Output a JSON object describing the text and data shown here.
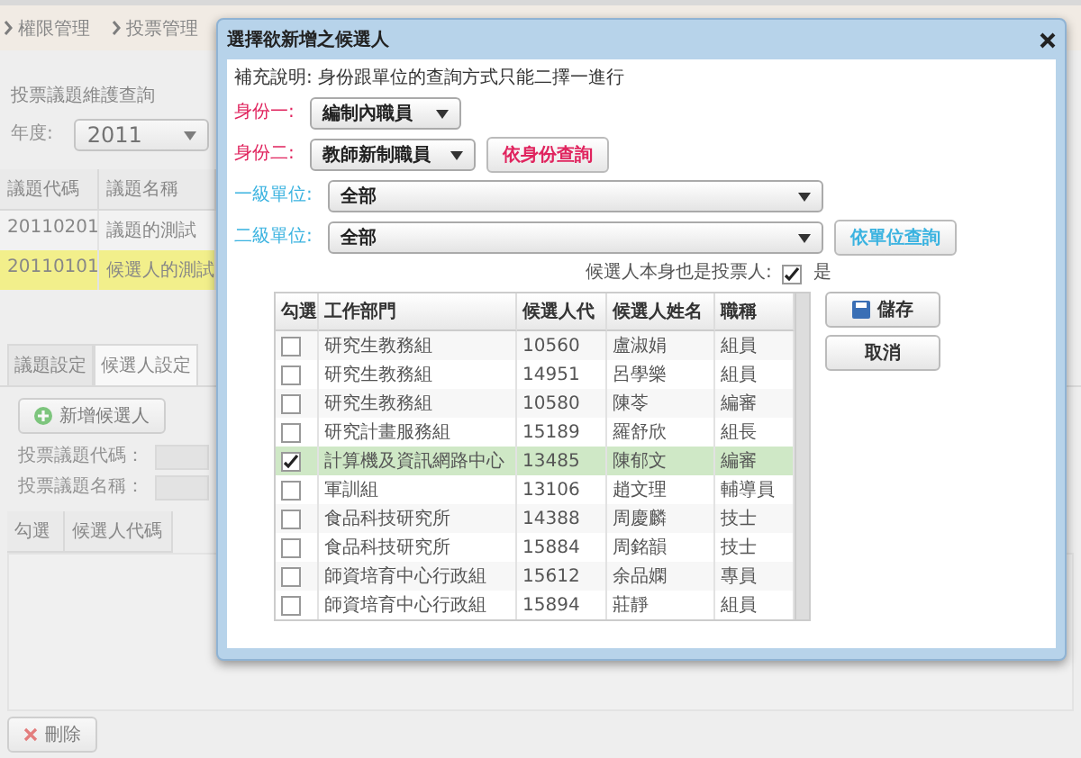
{
  "breadcrumb": [
    "權限管理",
    "投票管理"
  ],
  "query_panel": {
    "title": "投票議題維護查詢",
    "year_label": "年度:",
    "year_value": "2011"
  },
  "topic_table": {
    "columns": [
      "議題代碼",
      "議題名稱"
    ],
    "rows": [
      {
        "cells": [
          "20110201",
          "議題的測試"
        ],
        "selected": false
      },
      {
        "cells": [
          "20110101",
          "候選人的測試"
        ],
        "selected": true
      }
    ]
  },
  "tabs": [
    {
      "label": "議題設定",
      "selected": false
    },
    {
      "label": "候選人設定",
      "selected": true
    }
  ],
  "add_button": "新增候選人",
  "fields": [
    {
      "label": "投票議題代碼："
    },
    {
      "label": "投票議題名稱："
    }
  ],
  "candidate_table": {
    "columns": [
      "勾選",
      "候選人代碼"
    ]
  },
  "delete_button": "刪除",
  "dialog": {
    "title": "選擇欲新增之候選人",
    "note": "補充說明: 身份跟單位的查詢方式只能二擇一進行",
    "identity_1": {
      "label": "身份一:",
      "value": "編制內職員"
    },
    "identity_2": {
      "label": "身份二:",
      "value": "教師新制職員",
      "button": "依身份查詢"
    },
    "unit_1": {
      "label": "一級單位:",
      "value": "全部"
    },
    "unit_2": {
      "label": "二級單位:",
      "value": "全部",
      "button": "依單位查詢"
    },
    "also_voter": {
      "label": "候選人本身也是投票人:",
      "checked": true,
      "text": "是"
    },
    "check_column": "勾選",
    "columns": [
      "工作部門",
      "候選人代",
      "候選人姓名",
      "職稱"
    ],
    "rows": [
      {
        "checked": false,
        "selected": false,
        "cells": [
          "研究生教務組",
          "10560",
          "盧淑娟",
          "組員"
        ]
      },
      {
        "checked": false,
        "selected": false,
        "cells": [
          "研究生教務組",
          "14951",
          "呂學樂",
          "組員"
        ]
      },
      {
        "checked": false,
        "selected": false,
        "cells": [
          "研究生教務組",
          "10580",
          "陳苓",
          "編審"
        ]
      },
      {
        "checked": false,
        "selected": false,
        "cells": [
          "研究計畫服務組",
          "15189",
          "羅舒欣",
          "組長"
        ]
      },
      {
        "checked": true,
        "selected": true,
        "cells": [
          "計算機及資訊網路中心",
          "13485",
          "陳郁文",
          "編審"
        ]
      },
      {
        "checked": false,
        "selected": false,
        "cells": [
          "軍訓組",
          "13106",
          "趙文理",
          "輔導員"
        ]
      },
      {
        "checked": false,
        "selected": false,
        "cells": [
          "食品科技研究所",
          "14388",
          "周慶麟",
          "技士"
        ]
      },
      {
        "checked": false,
        "selected": false,
        "cells": [
          "食品科技研究所",
          "15884",
          "周銘韻",
          "技士"
        ]
      },
      {
        "checked": false,
        "selected": false,
        "cells": [
          "師資培育中心行政組",
          "15612",
          "余品嫻",
          "專員"
        ]
      },
      {
        "checked": false,
        "selected": false,
        "cells": [
          "師資培育中心行政組",
          "15894",
          "莊靜",
          "組員"
        ]
      }
    ],
    "save_button": "儲存",
    "cancel_button": "取消"
  }
}
